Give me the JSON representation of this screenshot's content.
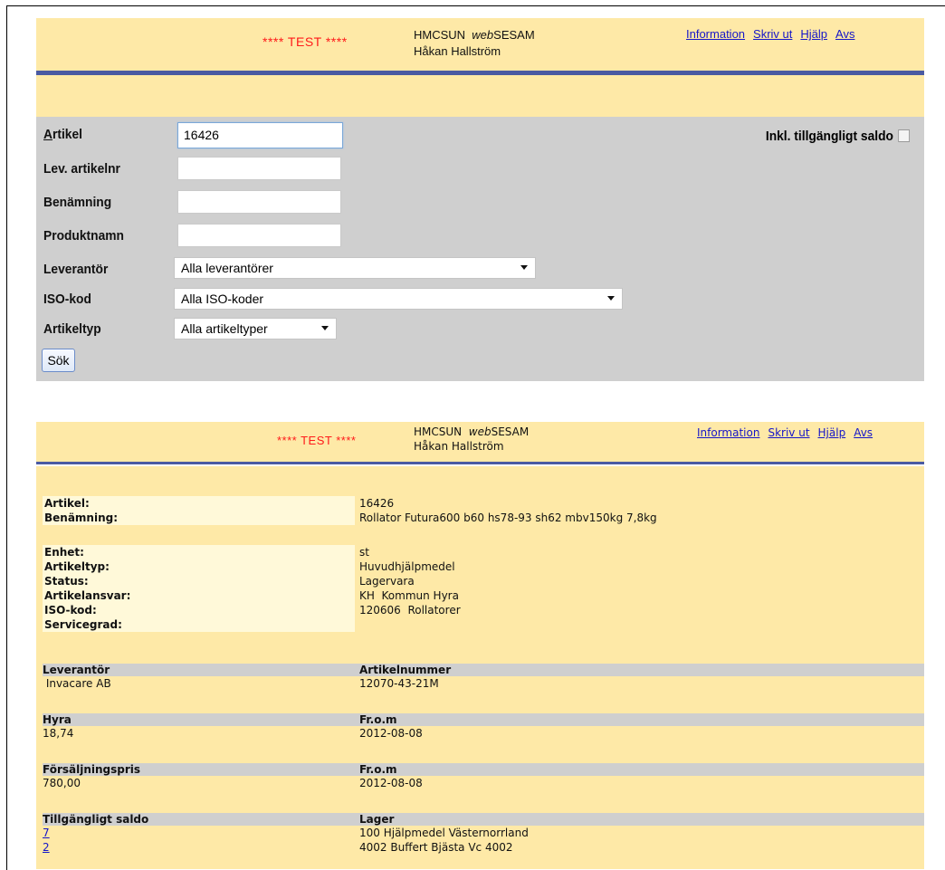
{
  "header": {
    "test_label": "**** TEST ****",
    "app_prefix": "HMCSUN",
    "app_web": "web",
    "app_name": "SESAM",
    "user": "Håkan Hallström",
    "links": [
      "Information",
      "Skriv ut",
      "Hjälp",
      "Avs"
    ]
  },
  "form": {
    "artikel_label": "Artikel",
    "artikel_value": "16426",
    "lev_label": "Lev. artikelnr",
    "ben_label": "Benämning",
    "prod_label": "Produktnamn",
    "leverantor_label": "Leverantör",
    "leverantor_value": "Alla leverantörer",
    "iso_label": "ISO-kod",
    "iso_value": "Alla ISO-koder",
    "artikeltyp_label": "Artikeltyp",
    "artikeltyp_value": "Alla artikeltyper",
    "saldo_label": "Inkl. tillgängligt saldo",
    "search_button": "Sök"
  },
  "detail": {
    "artikel_label": "Artikel:",
    "artikel": "16426",
    "benamning_label": "Benämning:",
    "benamning": "Rollator Futura600 b60 hs78-93 sh62 mbv150kg 7,8kg",
    "enhet_label": "Enhet:",
    "enhet": "st",
    "artikeltyp_label": "Artikeltyp:",
    "artikeltyp": "Huvudhjälpmedel",
    "status_label": "Status:",
    "status": "Lagervara",
    "ansvar_label": "Artikelansvar:",
    "ansvar": "KH  Kommun Hyra",
    "iso_label": "ISO-kod:",
    "iso": "120606  Rollatorer",
    "service_label": "Servicegrad:"
  },
  "groups": {
    "lev_header": "Leverantör",
    "artnr_header": "Artikelnummer",
    "leverantor": " Invacare AB",
    "artikelnummer": "12070-43-21M",
    "hyra_header": "Hyra",
    "hyra_from_header": "Fr.o.m",
    "hyra": "18,74",
    "hyra_from": "2012-08-08",
    "pris_header": "Försäljningspris",
    "pris_from_header": "Fr.o.m",
    "pris": "780,00",
    "pris_from": "2012-08-08",
    "saldo_header": "Tillgängligt saldo",
    "lager_header": "Lager",
    "rows": [
      {
        "saldo": "7",
        "lager": "100 Hjälpmedel Västernorrland"
      },
      {
        "saldo": "2",
        "lager": "4002 Buffert Bjästa Vc 4002"
      }
    ]
  }
}
